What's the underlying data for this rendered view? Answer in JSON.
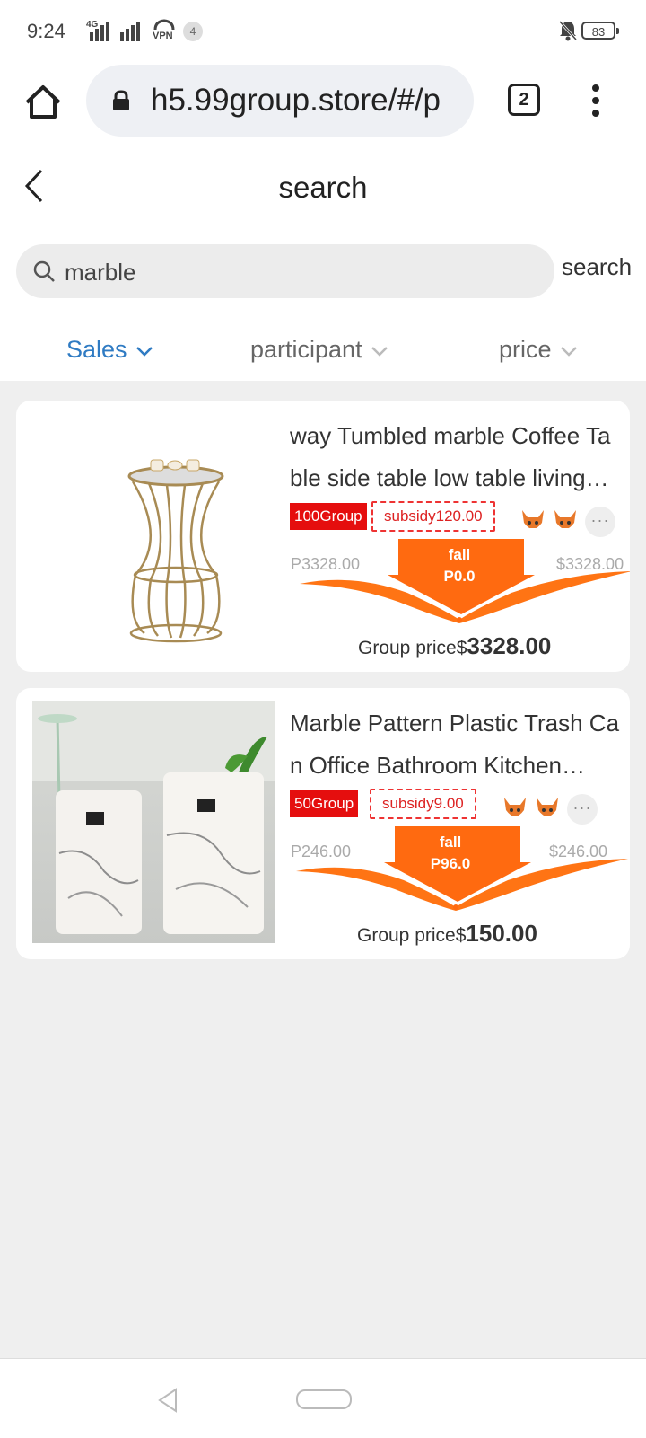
{
  "status_bar": {
    "time": "9:24",
    "network": "4G",
    "vpn": "VPN",
    "notifications": "4",
    "battery": "83"
  },
  "browser": {
    "url": "h5.99group.store/#/p",
    "tab_count": "2"
  },
  "page": {
    "title": "search"
  },
  "search": {
    "value": "marble",
    "button_label": "search"
  },
  "sort_tabs": [
    {
      "label": "Sales",
      "active": true
    },
    {
      "label": "participant",
      "active": false
    },
    {
      "label": "price",
      "active": false
    }
  ],
  "products": [
    {
      "title": "way Tumbled marble Coffee Table side table low table living…",
      "group": "100Group",
      "subsidy": "subsidy120.00",
      "price_left": "P3328.00",
      "price_right": "$3328.00",
      "fall_label": "fall",
      "fall_value": "P0.0",
      "group_price_label": "Group price$",
      "group_price": "3328.00"
    },
    {
      "title": "Marble Pattern Plastic Trash Can Office Bathroom Kitchen…",
      "group": "50Group",
      "subsidy": "subsidy9.00",
      "price_left": "P246.00",
      "price_right": "$246.00",
      "fall_label": "fall",
      "fall_value": "P96.0",
      "group_price_label": "Group price$",
      "group_price": "150.00"
    }
  ],
  "colors": {
    "accent": "#2f7bc3",
    "badge_red": "#e50e0e",
    "fall_orange": "#ff6a10"
  }
}
